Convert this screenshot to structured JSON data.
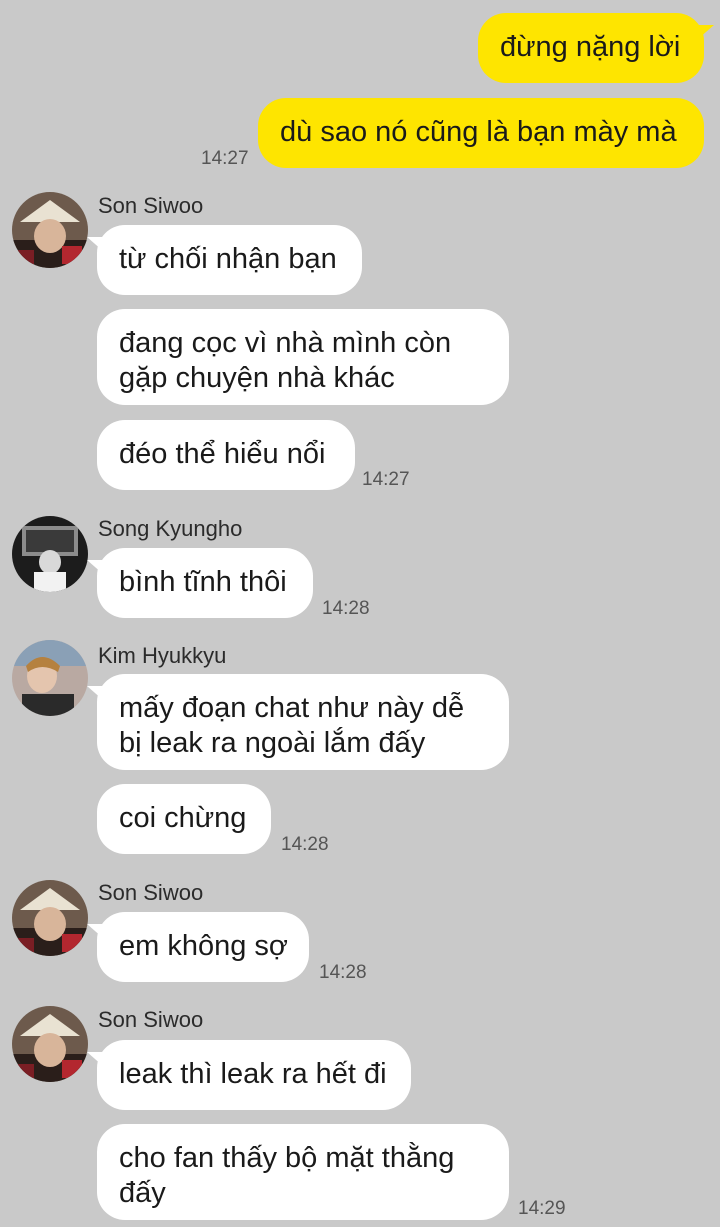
{
  "colors": {
    "background": "#c9c9c9",
    "my_bubble": "#fee500",
    "other_bubble": "#ffffff",
    "time": "#555555"
  },
  "messages": {
    "m1": {
      "text": "đừng nặng lời"
    },
    "m2": {
      "text": "dù sao nó cũng là bạn mày mà",
      "time": "14:27"
    },
    "g1": {
      "sender": "Son Siwoo",
      "b1": "từ chối nhận bạn",
      "b2": "đang cọc vì nhà mình còn gặp chuyện nhà khác",
      "b3": "đéo thể hiểu nổi",
      "time": "14:27"
    },
    "g2": {
      "sender": "Song Kyungho",
      "b1": "bình tĩnh thôi",
      "time": "14:28"
    },
    "g3": {
      "sender": "Kim Hyukkyu",
      "b1": "mấy đoạn chat như này dễ bị leak ra ngoài lắm đấy",
      "b2": "coi chừng",
      "time": "14:28"
    },
    "g4": {
      "sender": "Son Siwoo",
      "b1": "em không sợ",
      "time": "14:28"
    },
    "g5": {
      "sender": "Son Siwoo",
      "b1": "leak thì leak ra hết đi",
      "b2": "cho fan thấy bộ mặt thằng đấy",
      "time": "14:29"
    }
  }
}
